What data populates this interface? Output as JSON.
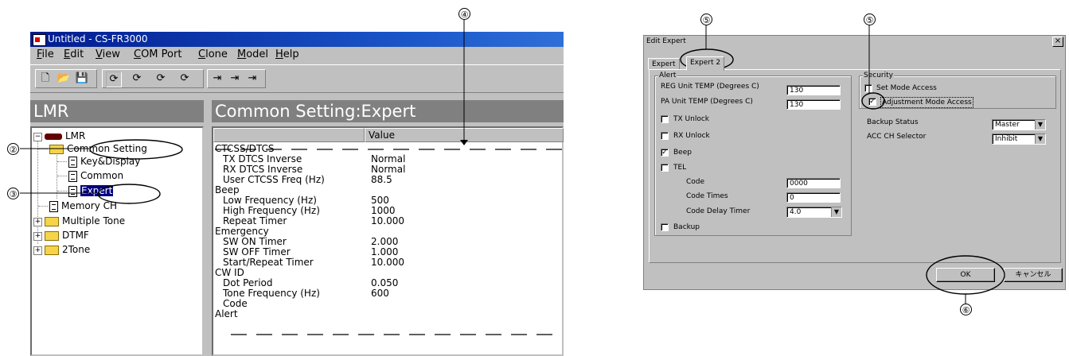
{
  "callouts": [
    "②",
    "③",
    "④",
    "⑤",
    "⑤",
    "⑥"
  ],
  "window": {
    "title": "Untitled - CS-FR3000",
    "menu": [
      "File",
      "Edit",
      "View",
      "COM Port",
      "Clone",
      "Model",
      "Help"
    ],
    "left_pane_title": "LMR",
    "right_pane_title": "Common Setting:Expert",
    "tree": {
      "root": "LMR",
      "items": [
        "Common Setting",
        "Key&Display",
        "Common",
        "Expert",
        "Memory CH",
        "Multiple Tone",
        "DTMF",
        "2Tone"
      ]
    },
    "grid": {
      "columns": [
        "",
        "Value"
      ],
      "sections": [
        {
          "name": "CTCSS/DTCS",
          "rows": [
            {
              "label": "TX DTCS Inverse",
              "value": "Normal"
            },
            {
              "label": "RX DTCS Inverse",
              "value": "Normal"
            },
            {
              "label": "User CTCSS Freq (Hz)",
              "value": "88.5"
            }
          ]
        },
        {
          "name": "Beep",
          "rows": [
            {
              "label": "Low Frequency (Hz)",
              "value": "500"
            },
            {
              "label": "High Frequency (Hz)",
              "value": "1000"
            },
            {
              "label": "Repeat Timer",
              "value": "10.000"
            }
          ]
        },
        {
          "name": "Emergency",
          "rows": [
            {
              "label": "SW ON Timer",
              "value": "2.000"
            },
            {
              "label": "SW OFF Timer",
              "value": "1.000"
            },
            {
              "label": "Start/Repeat Timer",
              "value": "10.000"
            }
          ]
        },
        {
          "name": "CW ID",
          "rows": [
            {
              "label": "Dot Period",
              "value": "0.050"
            },
            {
              "label": "Tone Frequency (Hz)",
              "value": "600"
            },
            {
              "label": "Code",
              "value": ""
            }
          ]
        },
        {
          "name": "Alert",
          "rows": []
        }
      ]
    }
  },
  "dialog": {
    "title": "Edit Expert",
    "close": "×",
    "tabs": [
      "Expert",
      "Expert 2"
    ],
    "alert_group": {
      "label": "Alert",
      "reg_temp_label": "REG Unit TEMP (Degrees C)",
      "reg_temp_value": "130",
      "pa_temp_label": "PA Unit TEMP (Degrees C)",
      "pa_temp_value": "130",
      "checks": [
        {
          "label": "TX Unlock",
          "checked": false
        },
        {
          "label": "RX Unlock",
          "checked": false
        },
        {
          "label": "Beep",
          "checked": true
        },
        {
          "label": "TEL",
          "checked": false
        }
      ],
      "code_label": "Code",
      "code_value": "0000",
      "code_times_label": "Code Times",
      "code_times_value": "0",
      "code_delay_label": "Code Delay Timer",
      "code_delay_value": "4.0",
      "backup_label": "Backup"
    },
    "security_group": {
      "label": "Security",
      "set_mode_label": "Set Mode Access",
      "adjust_mode_label": "Adjustment Mode Access",
      "backup_status_label": "Backup Status",
      "backup_status_value": "Master",
      "acc_label": "ACC CH Selector",
      "acc_value": "Inhibit"
    },
    "ok_label": "OK",
    "cancel_label": "キャンセル"
  }
}
